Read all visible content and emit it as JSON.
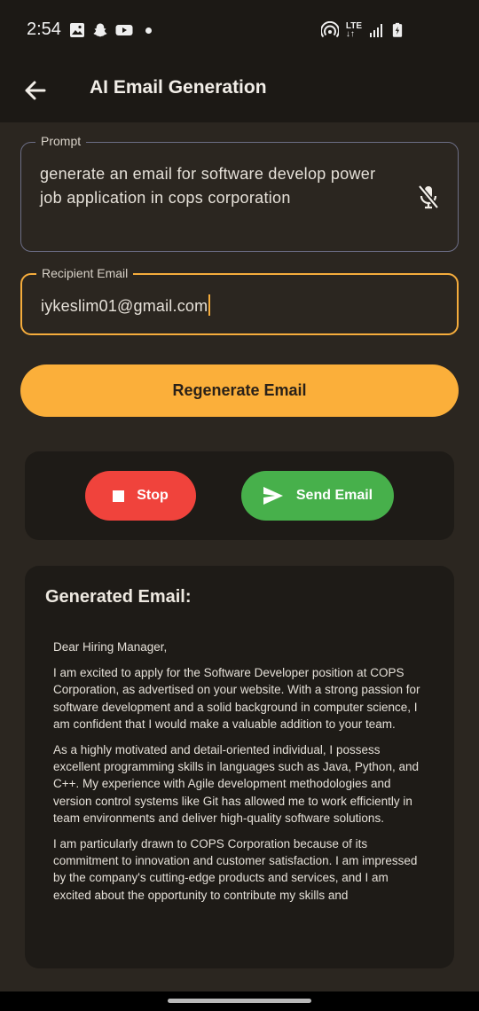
{
  "status_bar": {
    "time": "2:54",
    "network": "LTE"
  },
  "app_bar": {
    "title": "AI Email Generation",
    "back_icon": "arrow-back-icon"
  },
  "prompt": {
    "label": "Prompt",
    "value": "generate an email for software develop power job application in cops corporation",
    "mic_icon": "mic-off-icon"
  },
  "recipient": {
    "label": "Recipient Email",
    "value": "iykeslim01@gmail.com"
  },
  "regenerate_button": {
    "label": "Regenerate Email"
  },
  "actions": {
    "stop_label": "Stop",
    "send_label": "Send Email"
  },
  "generated": {
    "heading": "Generated Email:",
    "paragraphs": [
      "Dear Hiring Manager,",
      "I am excited to apply for the Software Developer position at COPS Corporation, as advertised on your website. With a strong passion for software development and a solid background in computer science, I am confident that I would make a valuable addition to your team.",
      "As a highly motivated and detail-oriented individual, I possess excellent programming skills in languages such as Java, Python, and C++. My experience with Agile development methodologies and version control systems like Git has allowed me to work efficiently in team environments and deliver high-quality software solutions.",
      "I am particularly drawn to COPS Corporation because of its commitment to innovation and customer satisfaction. I am impressed by the company's cutting-edge products and services, and I am excited about the opportunity to contribute my skills and"
    ]
  },
  "colors": {
    "accent": "#fbaf3a",
    "stop": "#f0433c",
    "send": "#47b04b",
    "background": "#2b2620",
    "card": "#1e1b17"
  }
}
